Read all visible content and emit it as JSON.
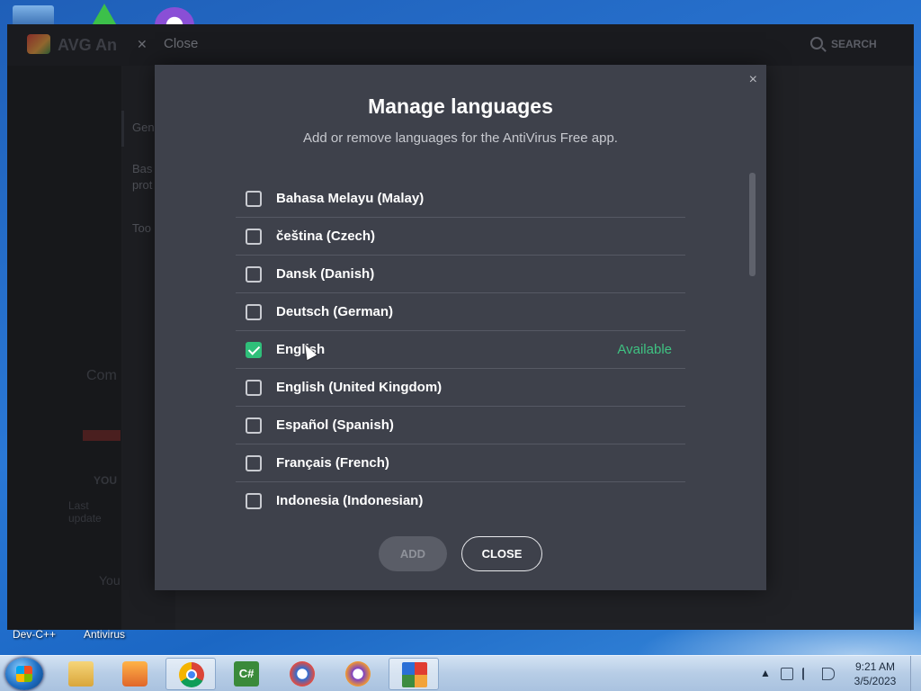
{
  "desktop": {
    "icon_labels": [
      "Dev-C++",
      "Antivirus"
    ]
  },
  "avg_window": {
    "title": "AVG An",
    "close_label": "Close",
    "search_label": "SEARCH",
    "side_items": [
      "Gen",
      "Bas",
      "prot",
      "Too"
    ],
    "ghost_texts": [
      "Com",
      "YOU",
      "Last update",
      "You"
    ]
  },
  "modal": {
    "title": "Manage languages",
    "subtitle": "Add or remove languages for the AntiVirus Free app.",
    "languages": [
      {
        "name": "Bahasa Melayu (Malay)",
        "checked": false,
        "status": ""
      },
      {
        "name": "čeština (Czech)",
        "checked": false,
        "status": ""
      },
      {
        "name": "Dansk (Danish)",
        "checked": false,
        "status": ""
      },
      {
        "name": "Deutsch (German)",
        "checked": false,
        "status": ""
      },
      {
        "name": "English",
        "checked": true,
        "status": "Available"
      },
      {
        "name": "English (United Kingdom)",
        "checked": false,
        "status": ""
      },
      {
        "name": "Español (Spanish)",
        "checked": false,
        "status": ""
      },
      {
        "name": "Français (French)",
        "checked": false,
        "status": ""
      },
      {
        "name": "Indonesia (Indonesian)",
        "checked": false,
        "status": ""
      }
    ],
    "add_label": "ADD",
    "close_label": "CLOSE",
    "close_icon": "×"
  },
  "taskbar": {
    "time": "9:21 AM",
    "date": "3/5/2023",
    "tray_arrow": "▲",
    "apps": [
      "file-explorer-icon",
      "media-player-icon",
      "chrome-icon",
      "csharp-icon",
      "avast-secure-browser-icon",
      "avg-secure-browser-icon",
      "avg-antivirus-icon"
    ]
  },
  "colors": {
    "modal_bg": "#3e414b",
    "accent_green": "#3fc282",
    "checkbox_checked": "#2fbf7a"
  }
}
